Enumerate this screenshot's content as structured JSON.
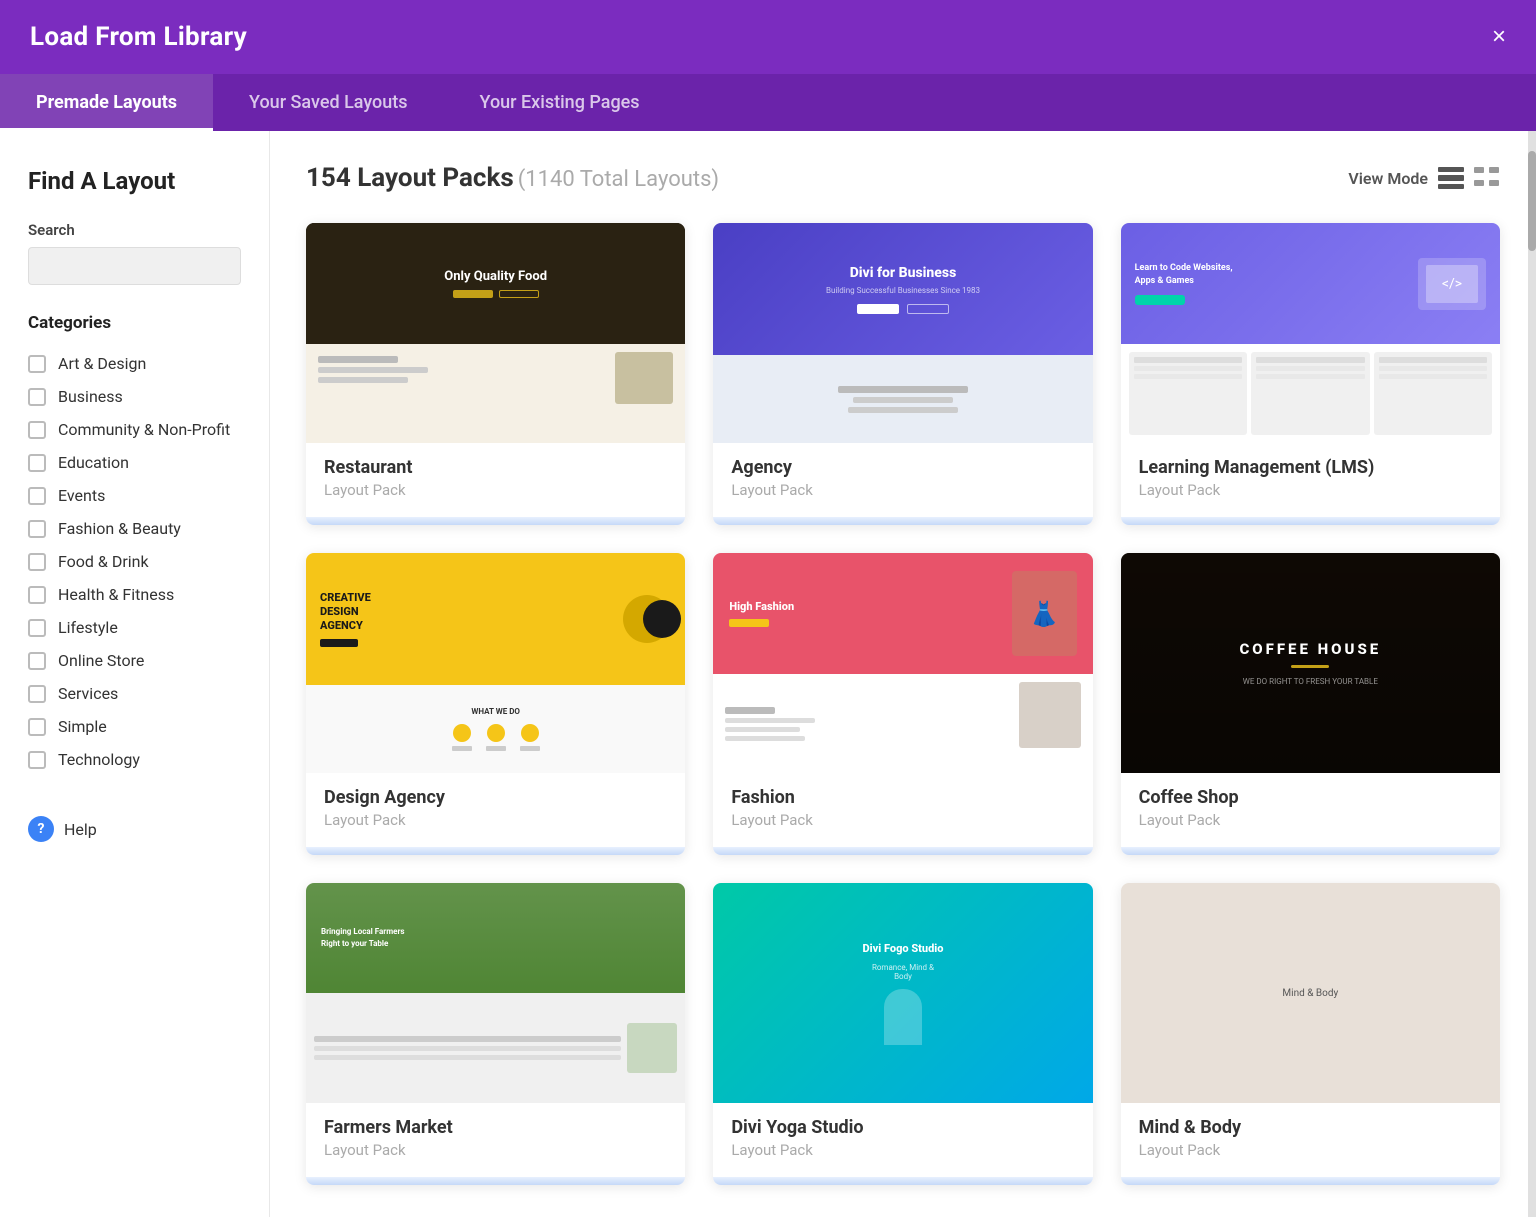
{
  "header": {
    "title": "Load From Library",
    "close_label": "×"
  },
  "tabs": [
    {
      "id": "premade",
      "label": "Premade Layouts",
      "active": true
    },
    {
      "id": "saved",
      "label": "Your Saved Layouts",
      "active": false
    },
    {
      "id": "existing",
      "label": "Your Existing Pages",
      "active": false
    }
  ],
  "sidebar": {
    "title": "Find A Layout",
    "search": {
      "label": "Search",
      "placeholder": ""
    },
    "categories_title": "Categories",
    "categories": [
      {
        "id": "art-design",
        "label": "Art & Design"
      },
      {
        "id": "business",
        "label": "Business"
      },
      {
        "id": "community-nonprofit",
        "label": "Community & Non-Profit"
      },
      {
        "id": "education",
        "label": "Education"
      },
      {
        "id": "events",
        "label": "Events"
      },
      {
        "id": "fashion-beauty",
        "label": "Fashion & Beauty"
      },
      {
        "id": "food-drink",
        "label": "Food & Drink"
      },
      {
        "id": "health-fitness",
        "label": "Health & Fitness"
      },
      {
        "id": "lifestyle",
        "label": "Lifestyle"
      },
      {
        "id": "online-store",
        "label": "Online Store"
      },
      {
        "id": "services",
        "label": "Services"
      },
      {
        "id": "simple",
        "label": "Simple"
      },
      {
        "id": "technology",
        "label": "Technology"
      }
    ],
    "help_label": "Help"
  },
  "main": {
    "layout_count": "154 Layout Packs",
    "layout_sub": "(1140 Total Layouts)",
    "view_mode_label": "View Mode",
    "cards": [
      {
        "id": "restaurant",
        "name": "Restaurant",
        "type": "Layout Pack",
        "preview_type": "restaurant"
      },
      {
        "id": "agency",
        "name": "Agency",
        "type": "Layout Pack",
        "preview_type": "agency"
      },
      {
        "id": "lms",
        "name": "Learning Management (LMS)",
        "type": "Layout Pack",
        "preview_type": "lms"
      },
      {
        "id": "design-agency",
        "name": "Design Agency",
        "type": "Layout Pack",
        "preview_type": "design-agency"
      },
      {
        "id": "fashion",
        "name": "Fashion",
        "type": "Layout Pack",
        "preview_type": "fashion"
      },
      {
        "id": "coffee-shop",
        "name": "Coffee Shop",
        "type": "Layout Pack",
        "preview_type": "coffee"
      },
      {
        "id": "farmers-market",
        "name": "Farmers Market",
        "type": "Layout Pack",
        "preview_type": "farmers"
      },
      {
        "id": "divi-yoga",
        "name": "Divi Yoga Studio",
        "type": "Layout Pack",
        "preview_type": "yoga"
      },
      {
        "id": "third-bottom",
        "name": "Mind & Body",
        "type": "Layout Pack",
        "preview_type": "third-bottom"
      }
    ]
  }
}
